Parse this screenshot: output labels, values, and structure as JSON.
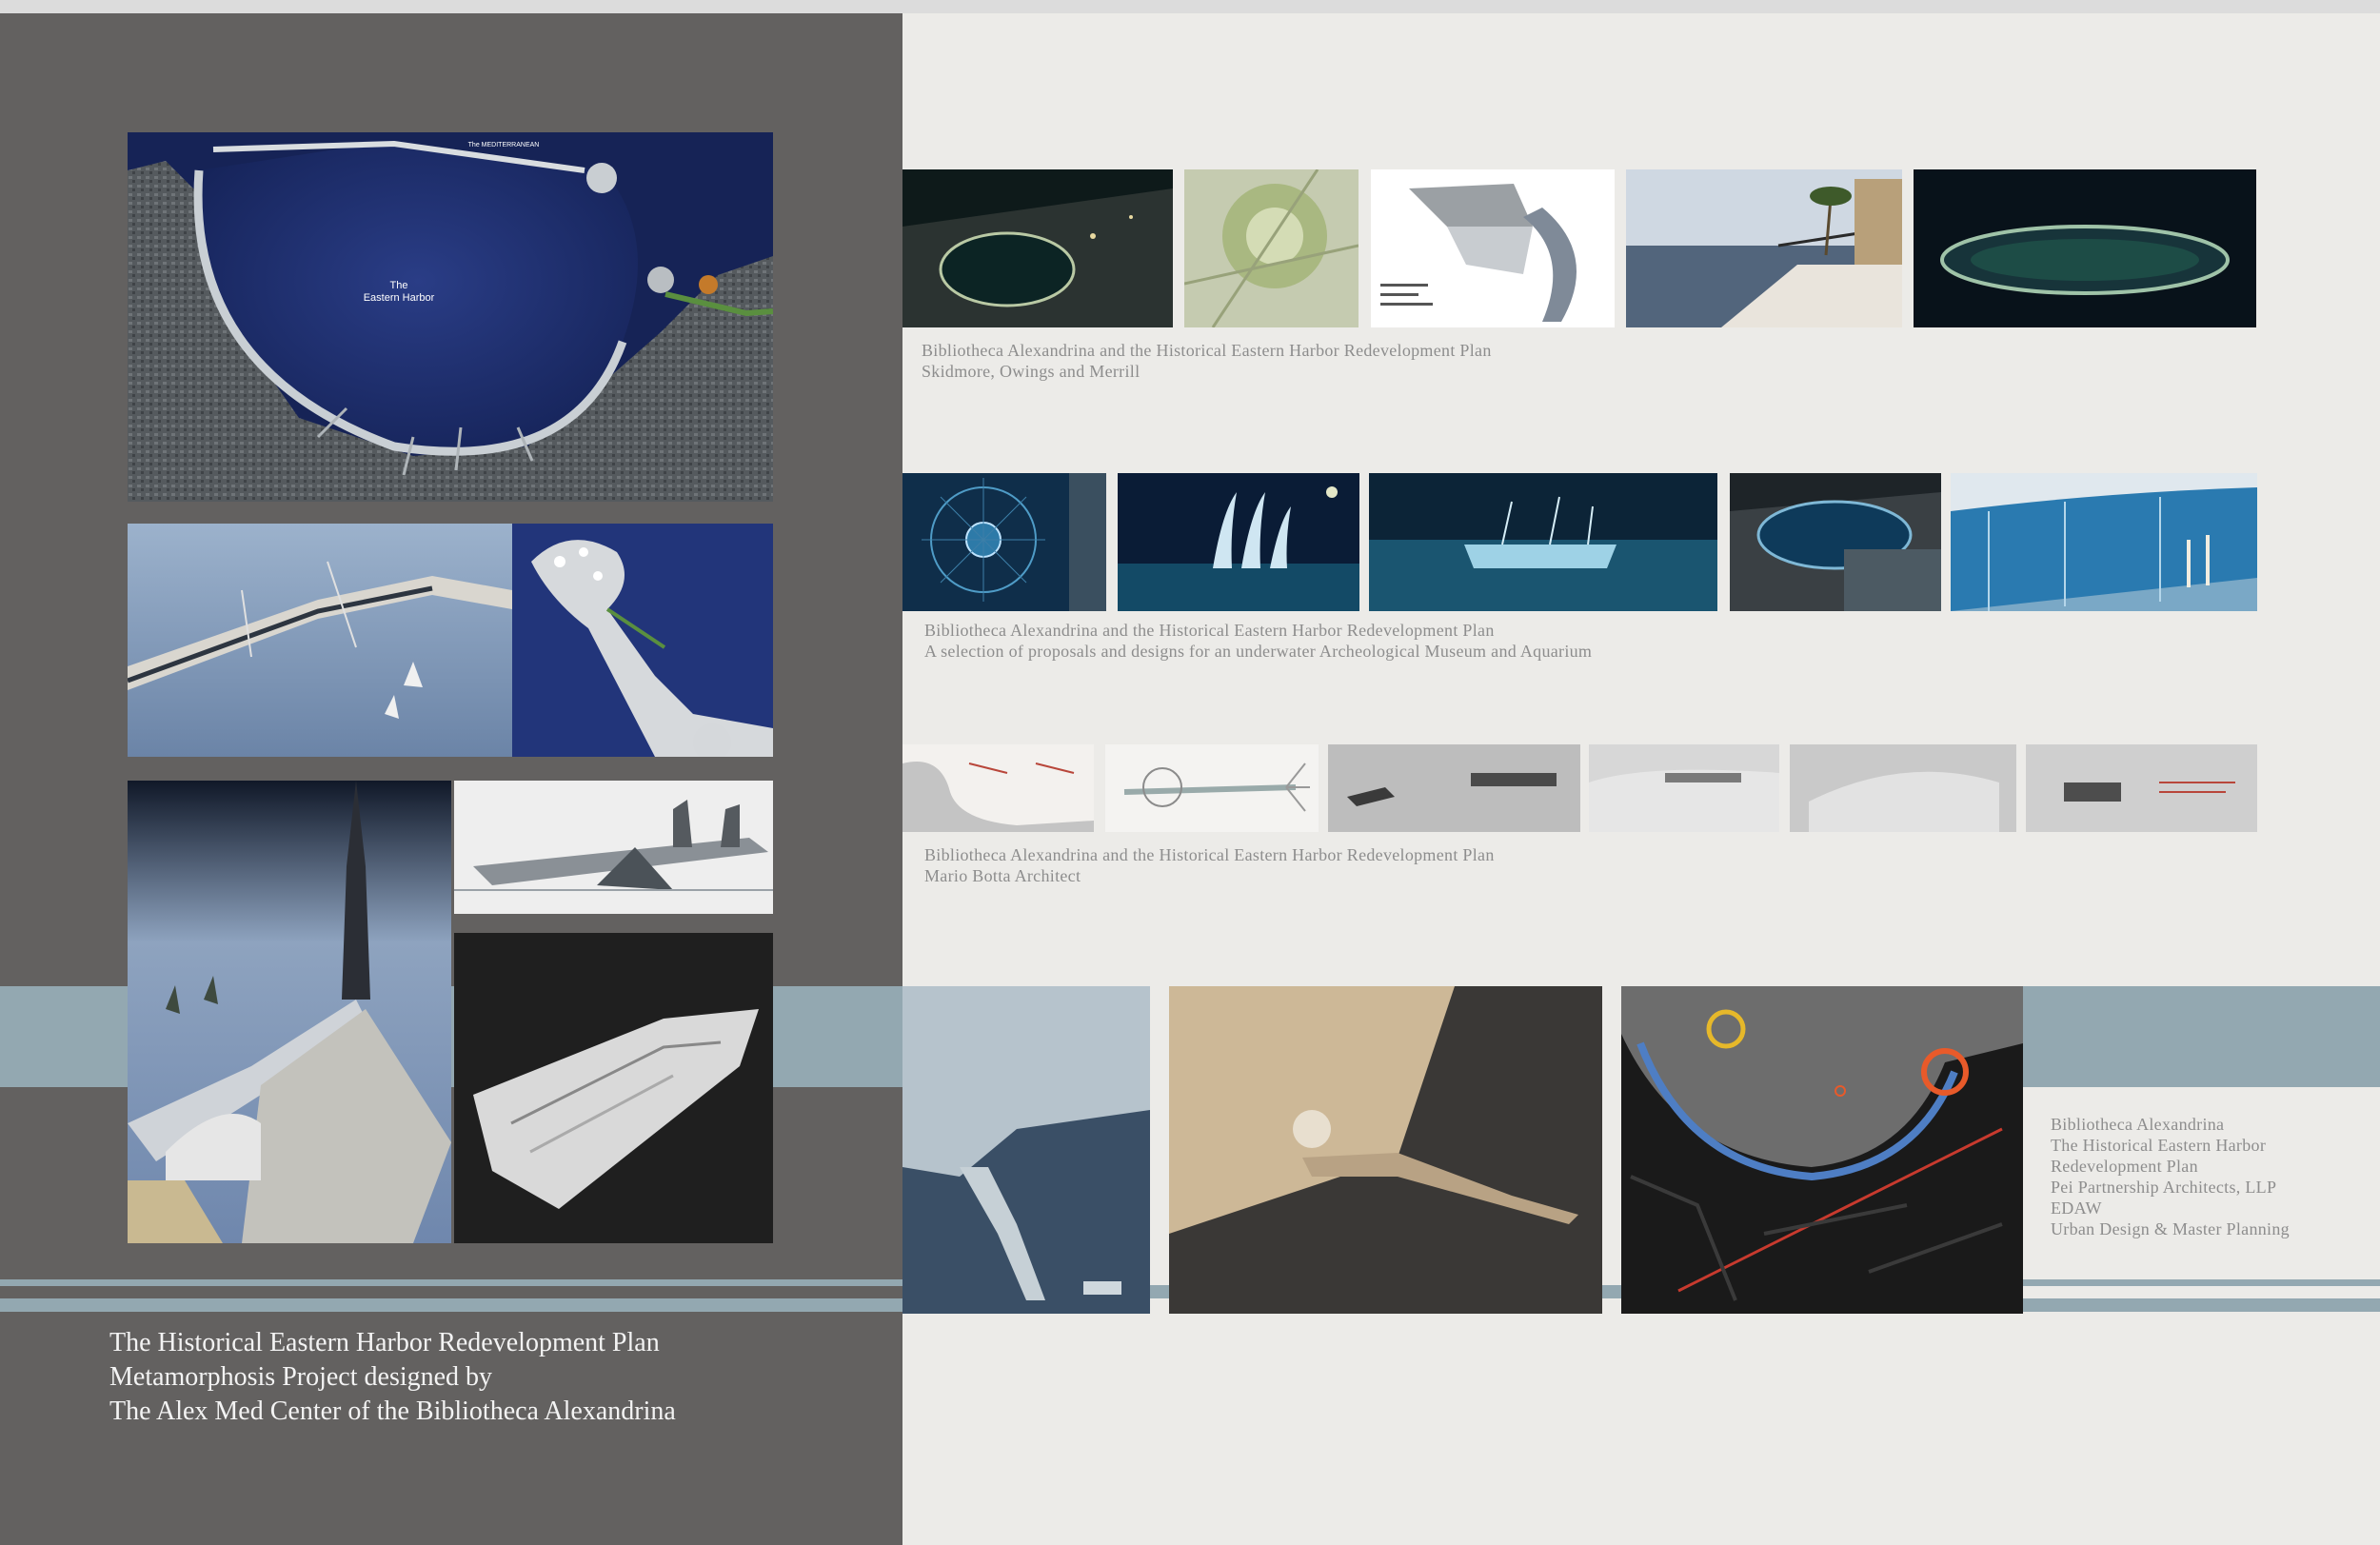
{
  "map_labels": {
    "harbor": "The\nEastern Harbor",
    "sea": "The MEDITERRANEAN"
  },
  "left_title": {
    "line1": "The Historical Eastern Harbor Redevelopment Plan",
    "line2": "Metamorphosis Project designed by",
    "line3": "The Alex Med Center of the Bibliotheca Alexandrina"
  },
  "captions": {
    "som": {
      "line1": "Bibliotheca Alexandrina and the Historical Eastern Harbor Redevelopment Plan",
      "line2": "Skidmore, Owings and Merrill"
    },
    "underwater": {
      "line1": "Bibliotheca Alexandrina and the Historical Eastern Harbor Redevelopment Plan",
      "line2": "A selection of proposals and designs for an underwater Archeological Museum and Aquarium"
    },
    "botta": {
      "line1": "Bibliotheca Alexandrina and the Historical Eastern Harbor Redevelopment Plan",
      "line2": "Mario Botta Architect"
    },
    "pei": {
      "line1": "Bibliotheca Alexandrina",
      "line2": "The Historical Eastern Harbor",
      "line3": "Redevelopment Plan",
      "line4": "Pei Partnership Architects, LLP",
      "line5": "EDAW",
      "line6": "Urban Design & Master Planning"
    }
  },
  "colors": {
    "left_panel": "#636160",
    "right_panel": "#ecebe8",
    "accent_band": "#93a8b1",
    "harbor_water": "#1e2f6a",
    "caption_text": "#8d8d8d",
    "title_text": "#f3f3f3"
  }
}
